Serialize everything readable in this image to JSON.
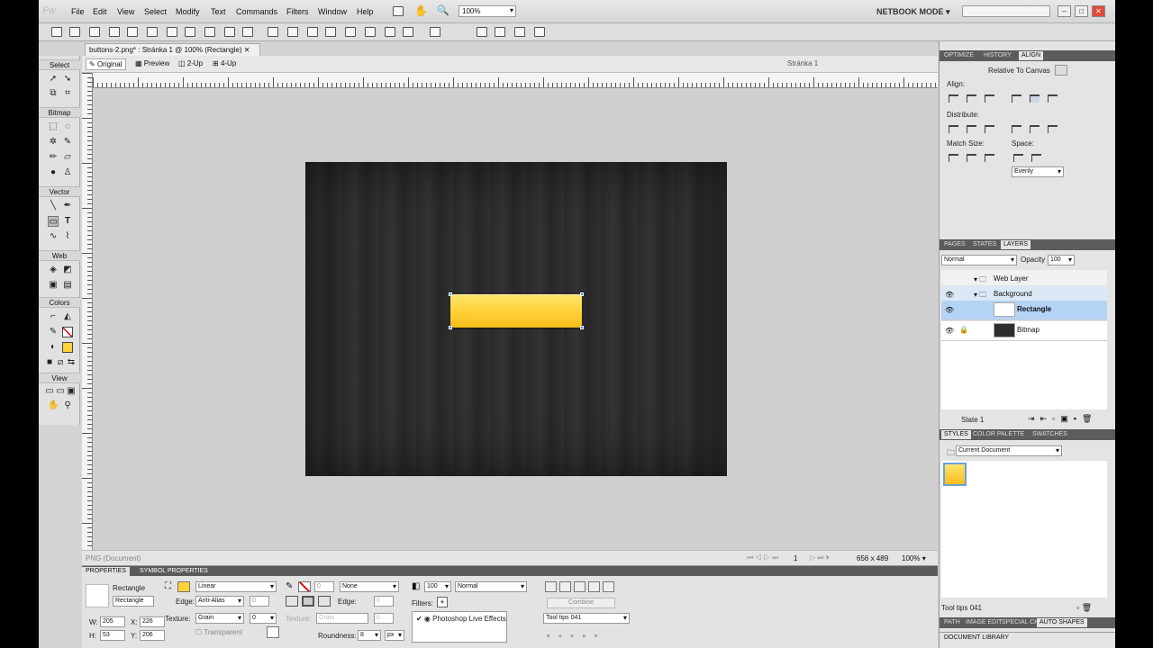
{
  "app": {
    "logo": "Fw"
  },
  "menu": [
    "File",
    "Edit",
    "View",
    "Select",
    "Modify",
    "Text",
    "Commands",
    "Filters",
    "Window",
    "Help"
  ],
  "toolbar": {
    "zoom": "100%",
    "workspace": "NETBOOK MODE"
  },
  "document": {
    "tab_title": "buttons-2.png* : Stránka 1 @ 100% (Rectangle)",
    "views": [
      "Original",
      "Preview",
      "2-Up",
      "4-Up"
    ],
    "page_label": "Stránka 1"
  },
  "tools": {
    "sections": [
      "Select",
      "Bitmap",
      "Vector",
      "Web",
      "Colors",
      "View"
    ]
  },
  "status": {
    "doc_type": "PNG (Document)",
    "page_num": "1",
    "size": "656 x 489",
    "zoom": "100%"
  },
  "properties": {
    "tabs": [
      "PROPERTIES",
      "SYMBOL PROPERTIES"
    ],
    "object_type": "Rectangle",
    "object_name": "Rectangle",
    "w_label": "W:",
    "w": "205",
    "h_label": "H:",
    "h": "53",
    "x_label": "X:",
    "x": "226",
    "y_label": "Y:",
    "y": "206",
    "fill_type": "Linear",
    "edge_label": "Edge:",
    "edge": "Anti-Alias",
    "edge_val": "0",
    "texture_label": "Texture:",
    "texture": "Grain",
    "texture_val": "0",
    "transparent": "Transparent",
    "stroke_val": "0",
    "stroke_type": "None",
    "stroke_edge_label": "Edge:",
    "stroke_edge_val": "0",
    "stroke_texture_label": "Texture:",
    "stroke_texture": "Grain",
    "stroke_texture_val": "0",
    "roundness_label": "Roundness:",
    "roundness": "8",
    "roundness_unit": "px",
    "opacity": "100",
    "blend": "Normal",
    "filters_label": "Filters:",
    "filter_item": "Photoshop Live Effects",
    "combine": "Combine",
    "tooltip": "Tool tips 041"
  },
  "align_panel": {
    "tabs": [
      "OPTIMIZE",
      "HISTORY",
      "ALIGN"
    ],
    "relative": "Relative To Canvas",
    "align_label": "Align:",
    "distribute_label": "Distribute:",
    "match_label": "Match Size:",
    "space_label": "Space:",
    "space_option": "Evenly"
  },
  "layers_panel": {
    "tabs": [
      "PAGES",
      "STATES",
      "LAYERS"
    ],
    "blend": "Normal",
    "opacity_label": "Opacity",
    "opacity": "100",
    "layers": [
      "Web Layer",
      "Background",
      "Rectangle",
      "Bitmap"
    ],
    "state": "State 1"
  },
  "styles_panel": {
    "tabs": [
      "STYLES",
      "COLOR PALETTE",
      "SWATCHES"
    ],
    "source": "Current Document",
    "footer": "Tool tips 041"
  },
  "bottom_tabs": [
    "PATH",
    "IMAGE EDIT",
    "SPECIAL CH.",
    "AUTO SHAPES"
  ],
  "doc_library": "DOCUMENT LIBRARY",
  "colors": {
    "accent_blue": "#1f8fff",
    "button_yellow": "#ffd23a",
    "selection": "#b5d3f5"
  }
}
